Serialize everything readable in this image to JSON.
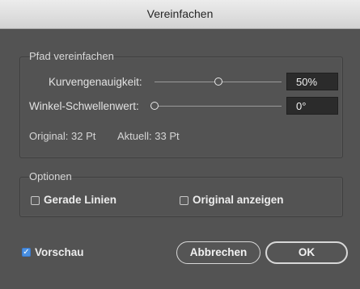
{
  "window": {
    "title": "Vereinfachen"
  },
  "path_group": {
    "legend": "Pfad vereinfachen",
    "curve_accuracy": {
      "label": "Kurvengenauigkeit:",
      "value": "50%",
      "level": 0.5
    },
    "angle_threshold": {
      "label": "Winkel-Schwellenwert:",
      "value": "0°",
      "level": 0.0
    },
    "original": "Original: 32 Pt",
    "current": "Aktuell: 33 Pt"
  },
  "options_group": {
    "legend": "Optionen",
    "straight_lines": {
      "label": "Gerade Linien",
      "checked": false
    },
    "show_original": {
      "label": "Original anzeigen",
      "checked": false
    }
  },
  "preview": {
    "label": "Vorschau",
    "checked": true
  },
  "buttons": {
    "cancel": "Abbrechen",
    "ok": "OK"
  },
  "colors": {
    "dialog_bg": "#535353",
    "checkbox_accent": "#4a90e2"
  }
}
